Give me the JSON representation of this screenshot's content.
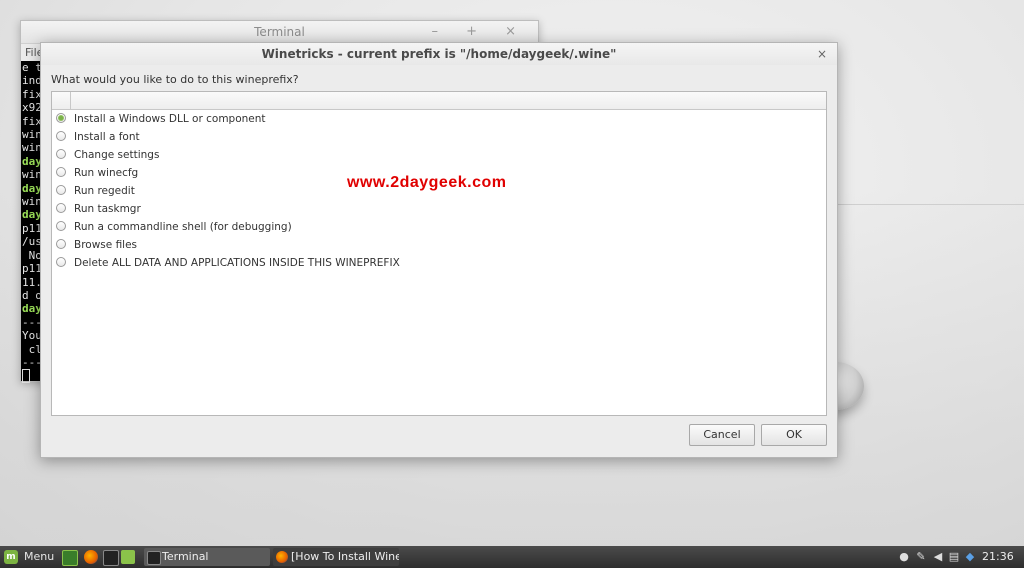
{
  "terminal": {
    "title": "Terminal",
    "window_controls": "– + ×",
    "menu_first": "File",
    "lines": [
      {
        "text": "e t",
        "green": false
      },
      {
        "text": "ind",
        "green": false
      },
      {
        "text": "fix",
        "green": false
      },
      {
        "text": "x92",
        "green": false
      },
      {
        "text": "fix",
        "green": false
      },
      {
        "text": "win",
        "green": false
      },
      {
        "text": "win",
        "green": false
      },
      {
        "text": "day",
        "green": true
      },
      {
        "text": "win",
        "green": false
      },
      {
        "text": "day",
        "green": true
      },
      {
        "text": "win",
        "green": false
      },
      {
        "text": "day",
        "green": true
      },
      {
        "text": "p11",
        "green": false
      },
      {
        "text": "/us",
        "green": false
      },
      {
        "text": " No",
        "green": false
      },
      {
        "text": "p11",
        "green": false
      },
      {
        "text": "11.",
        "green": false
      },
      {
        "text": "d o",
        "green": false
      },
      {
        "text": "day",
        "green": true
      },
      {
        "text": "---",
        "green": false
      },
      {
        "text": "You",
        "green": false
      },
      {
        "text": " cl",
        "green": false
      },
      {
        "text": "---",
        "green": false
      }
    ]
  },
  "dialog": {
    "title": "Winetricks - current prefix is \"/home/daygeek/.wine\"",
    "close_glyph": "×",
    "prompt": "What would you like to do to this wineprefix?",
    "options": [
      {
        "label": "Install a Windows DLL or component",
        "checked": true
      },
      {
        "label": "Install a font",
        "checked": false
      },
      {
        "label": "Change settings",
        "checked": false
      },
      {
        "label": "Run winecfg",
        "checked": false
      },
      {
        "label": "Run regedit",
        "checked": false
      },
      {
        "label": "Run taskmgr",
        "checked": false
      },
      {
        "label": "Run a commandline shell (for debugging)",
        "checked": false
      },
      {
        "label": "Browse files",
        "checked": false
      },
      {
        "label": "Delete ALL DATA AND APPLICATIONS INSIDE THIS WINEPREFIX",
        "checked": false
      }
    ],
    "watermark": "www.2daygeek.com",
    "cancel_label": "Cancel",
    "ok_label": "OK"
  },
  "taskbar": {
    "menu_label": "Menu",
    "windows": [
      {
        "label": "Terminal",
        "icon": "terminal-icon"
      },
      {
        "label": "[How To Install Wine...",
        "icon": "firefox-icon"
      }
    ],
    "tray_icons": [
      "user-icon",
      "pen-icon",
      "volume-icon",
      "network-icon",
      "battery-icon",
      "shield-icon"
    ],
    "clock": "21:36",
    "colors": {
      "mint_green": "#7cb342",
      "firefox_orange": "#e66000",
      "folder_green": "#8bc34a"
    }
  }
}
